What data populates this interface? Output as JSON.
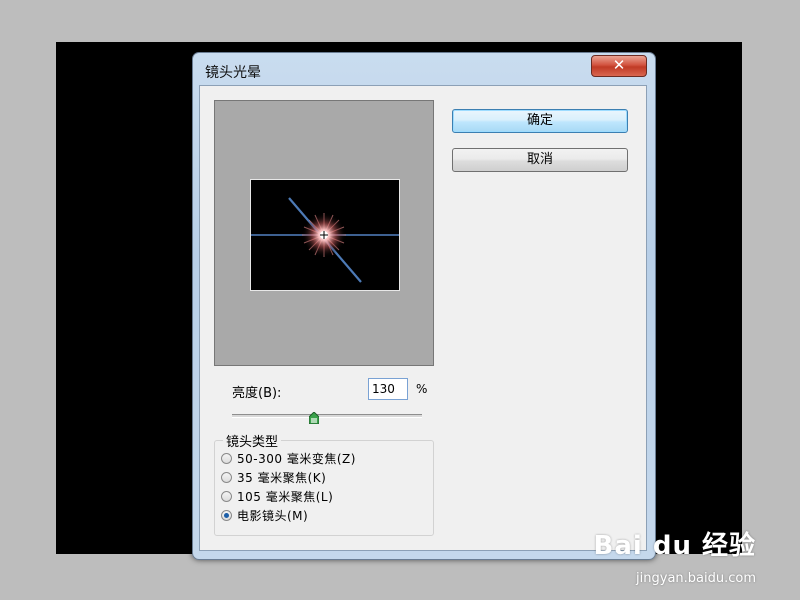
{
  "dialog": {
    "title": "镜头光晕",
    "close_glyph": "✕"
  },
  "buttons": {
    "ok_label": "确定",
    "cancel_label": "取消"
  },
  "brightness": {
    "label": "亮度(B):",
    "value": "130",
    "unit": "%",
    "slider_fraction": 0.43
  },
  "lens_type": {
    "group_title": "镜头类型",
    "options": [
      {
        "label": "50-300 毫米变焦(Z)",
        "checked": false
      },
      {
        "label": "35 毫米聚焦(K)",
        "checked": false
      },
      {
        "label": "105 毫米聚焦(L)",
        "checked": false
      },
      {
        "label": "电影镜头(M)",
        "checked": true
      }
    ]
  },
  "watermark": {
    "logo_text": "Bai du 经验",
    "url": "jingyan.baidu.com"
  },
  "colors": {
    "accent_blue": "#1c5ea8",
    "close_red": "#c03a25",
    "flare_core": "#ffb2b2",
    "flare_streak": "#5b8fd6"
  },
  "icons": {
    "close": "close-icon",
    "slider_thumb": "slider-thumb-icon",
    "lens_flare": "lens-flare-image"
  }
}
